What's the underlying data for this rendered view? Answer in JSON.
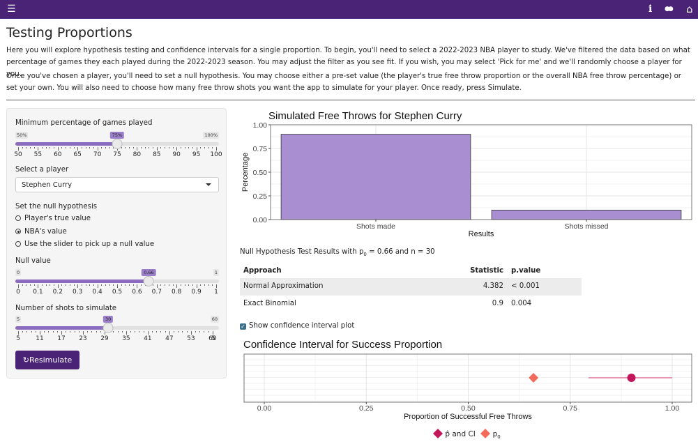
{
  "topbar": {
    "menu_icon": "hamburger-icon",
    "info_icon": "info-icon",
    "chat_icon": "comments-icon",
    "home_icon": "home-icon",
    "info_glyph": "i",
    "chat_glyph": "●●",
    "home_glyph": "⌂",
    "menu_glyph": "☰"
  },
  "page": {
    "title": "Testing Proportions",
    "para1": "Here you will explore hypothesis testing and confidence intervals for a single proportion. To begin, you'll need to select a 2022-2023 NBA player to study. We've filtered the data based on what percentage of games they each played during the 2022-2023 season. You may adjust the filter as you see fit. If you wish, you may select 'Pick for me' and we'll randomly choose a player for you.",
    "para2": "Once you've chosen a player, you'll need to set a null hypothesis. You may choose either a pre-set value (the player's true free throw proportion or the overall NBA free throw percentage) or set your own. You will also need to choose how many free throw shots you want the app to simulate for your player. Once ready, press Simulate."
  },
  "sidebar": {
    "games_label": "Minimum percentage of games played",
    "games_slider": {
      "min": 50,
      "max": 100,
      "value": 75,
      "min_label": "50%",
      "max_label": "100%",
      "cur_label": "75%",
      "tick_labels": [
        "50",
        "55",
        "60",
        "65",
        "70",
        "75",
        "80",
        "85",
        "90",
        "95",
        "100"
      ],
      "minor_per": 5
    },
    "player_label": "Select a player",
    "player_value": "Stephen Curry",
    "null_label": "Set the null hypothesis",
    "radio_options": [
      "Player's true value",
      "NBA's value",
      "Use the slider to pick up a null value"
    ],
    "radio_selected": 1,
    "null_value_label": "Null value",
    "null_slider": {
      "min": 0,
      "max": 1,
      "value": 0.66,
      "min_label": "0",
      "max_label": "1",
      "cur_label": "0.66",
      "tick_labels": [
        "0",
        "0.1",
        "0.2",
        "0.3",
        "0.4",
        "0.5",
        "0.6",
        "0.7",
        "0.8",
        "0.9",
        "1"
      ],
      "minor_per": 5
    },
    "shots_label": "Number of shots to simulate",
    "shots_slider": {
      "min": 5,
      "max": 60,
      "value": 30,
      "min_label": "5",
      "max_label": "60",
      "cur_label": "30",
      "tick_labels": [
        "5",
        "11",
        "17",
        "23",
        "29",
        "35",
        "41",
        "47",
        "53",
        "60"
      ],
      "tick_values": [
        5,
        11,
        17,
        23,
        29,
        35,
        41,
        47,
        53,
        59
      ],
      "extra_tick_label": "5",
      "minor_per": 5
    },
    "resimulate_label": "↻Resimulate"
  },
  "results": {
    "heading_pre": "Null Hypothesis Test Results with p",
    "heading_sub": "0",
    "heading_post": " = 0.66 and n = 30",
    "columns": [
      "Approach",
      "Statistic",
      "p.value"
    ],
    "rows": [
      [
        "Normal Approximation",
        "4.382",
        "< 0.001"
      ],
      [
        "Exact Binomial",
        "0.9",
        "0.004"
      ]
    ],
    "checkbox_label": "Show confidence interval plot",
    "checkbox_mark": "✓"
  },
  "colors": {
    "bar": "#a98fd2",
    "phat": "#c2185b",
    "p0": "#f26b5b",
    "ci": "#e6799b",
    "brand": "#4a2376"
  },
  "chart_data": [
    {
      "type": "bar",
      "title": "Simulated Free Throws for Stephen Curry",
      "categories": [
        "Shots made",
        "Shots missed"
      ],
      "values": [
        0.9,
        0.1
      ],
      "xlabel": "Results",
      "ylabel": "Percentage",
      "ylim": [
        0,
        1
      ],
      "yticks": [
        0,
        0.25,
        0.5,
        0.75,
        1
      ],
      "ytick_labels": [
        "0.00",
        "0.25",
        "0.50",
        "0.75",
        "1.00"
      ],
      "grid": true
    },
    {
      "type": "scatter",
      "title": "Confidence Interval for Success Proportion",
      "xlabel": "Proportion of Successful Free Throws",
      "xlim": [
        0,
        1
      ],
      "xticks": [
        0,
        0.25,
        0.5,
        0.75,
        1
      ],
      "xtick_labels": [
        "0.00",
        "0.25",
        "0.50",
        "0.75",
        "1.00"
      ],
      "phat": 0.9,
      "ci": [
        0.795,
        1.0
      ],
      "p0": 0.66,
      "legend": [
        {
          "name": "p̂ and CI",
          "pre": "p̂",
          "post": " and CI",
          "symbol": "diamond"
        },
        {
          "name": "p0",
          "pre": "p",
          "sub": "0",
          "symbol": "diamond"
        }
      ],
      "grid": true
    }
  ]
}
